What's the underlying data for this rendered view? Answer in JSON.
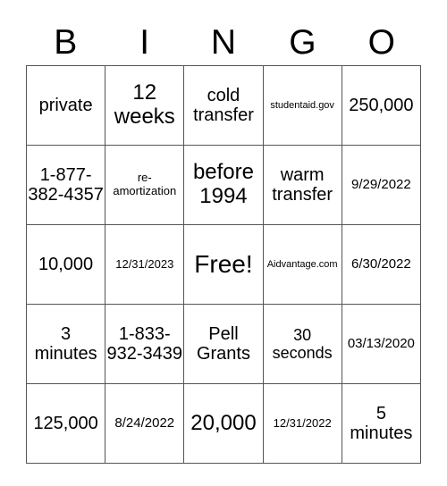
{
  "header": [
    "B",
    "I",
    "N",
    "G",
    "O"
  ],
  "cells": [
    [
      {
        "text": "private",
        "size": "s-m"
      },
      {
        "text": "12 weeks",
        "size": "s-l"
      },
      {
        "text": "cold transfer",
        "size": "s-m"
      },
      {
        "text": "studentaid.gov",
        "size": "s-xxs"
      },
      {
        "text": "250,000",
        "size": "s-m"
      }
    ],
    [
      {
        "text": "1-877-382-4357",
        "size": "s-m"
      },
      {
        "text": "re-amortization",
        "size": "s-xs"
      },
      {
        "text": "before 1994",
        "size": "s-l"
      },
      {
        "text": "warm transfer",
        "size": "s-m"
      },
      {
        "text": "9/29/2022",
        "size": "s-s"
      }
    ],
    [
      {
        "text": "10,000",
        "size": "s-m"
      },
      {
        "text": "12/31/2023",
        "size": "s-xs"
      },
      {
        "text": "Free!",
        "size": "s-xl"
      },
      {
        "text": "Aidvantage.com",
        "size": "s-xxs"
      },
      {
        "text": "6/30/2022",
        "size": "s-s"
      }
    ],
    [
      {
        "text": "3 minutes",
        "size": "s-m"
      },
      {
        "text": "1-833-932-3439",
        "size": "s-m"
      },
      {
        "text": "Pell Grants",
        "size": "s-m"
      },
      {
        "text": "30 seconds",
        "size": "s-md"
      },
      {
        "text": "03/13/2020",
        "size": "s-s"
      }
    ],
    [
      {
        "text": "125,000",
        "size": "s-m"
      },
      {
        "text": "8/24/2022",
        "size": "s-s"
      },
      {
        "text": "20,000",
        "size": "s-l"
      },
      {
        "text": "12/31/2022",
        "size": "s-xs"
      },
      {
        "text": "5 minutes",
        "size": "s-m"
      }
    ]
  ]
}
